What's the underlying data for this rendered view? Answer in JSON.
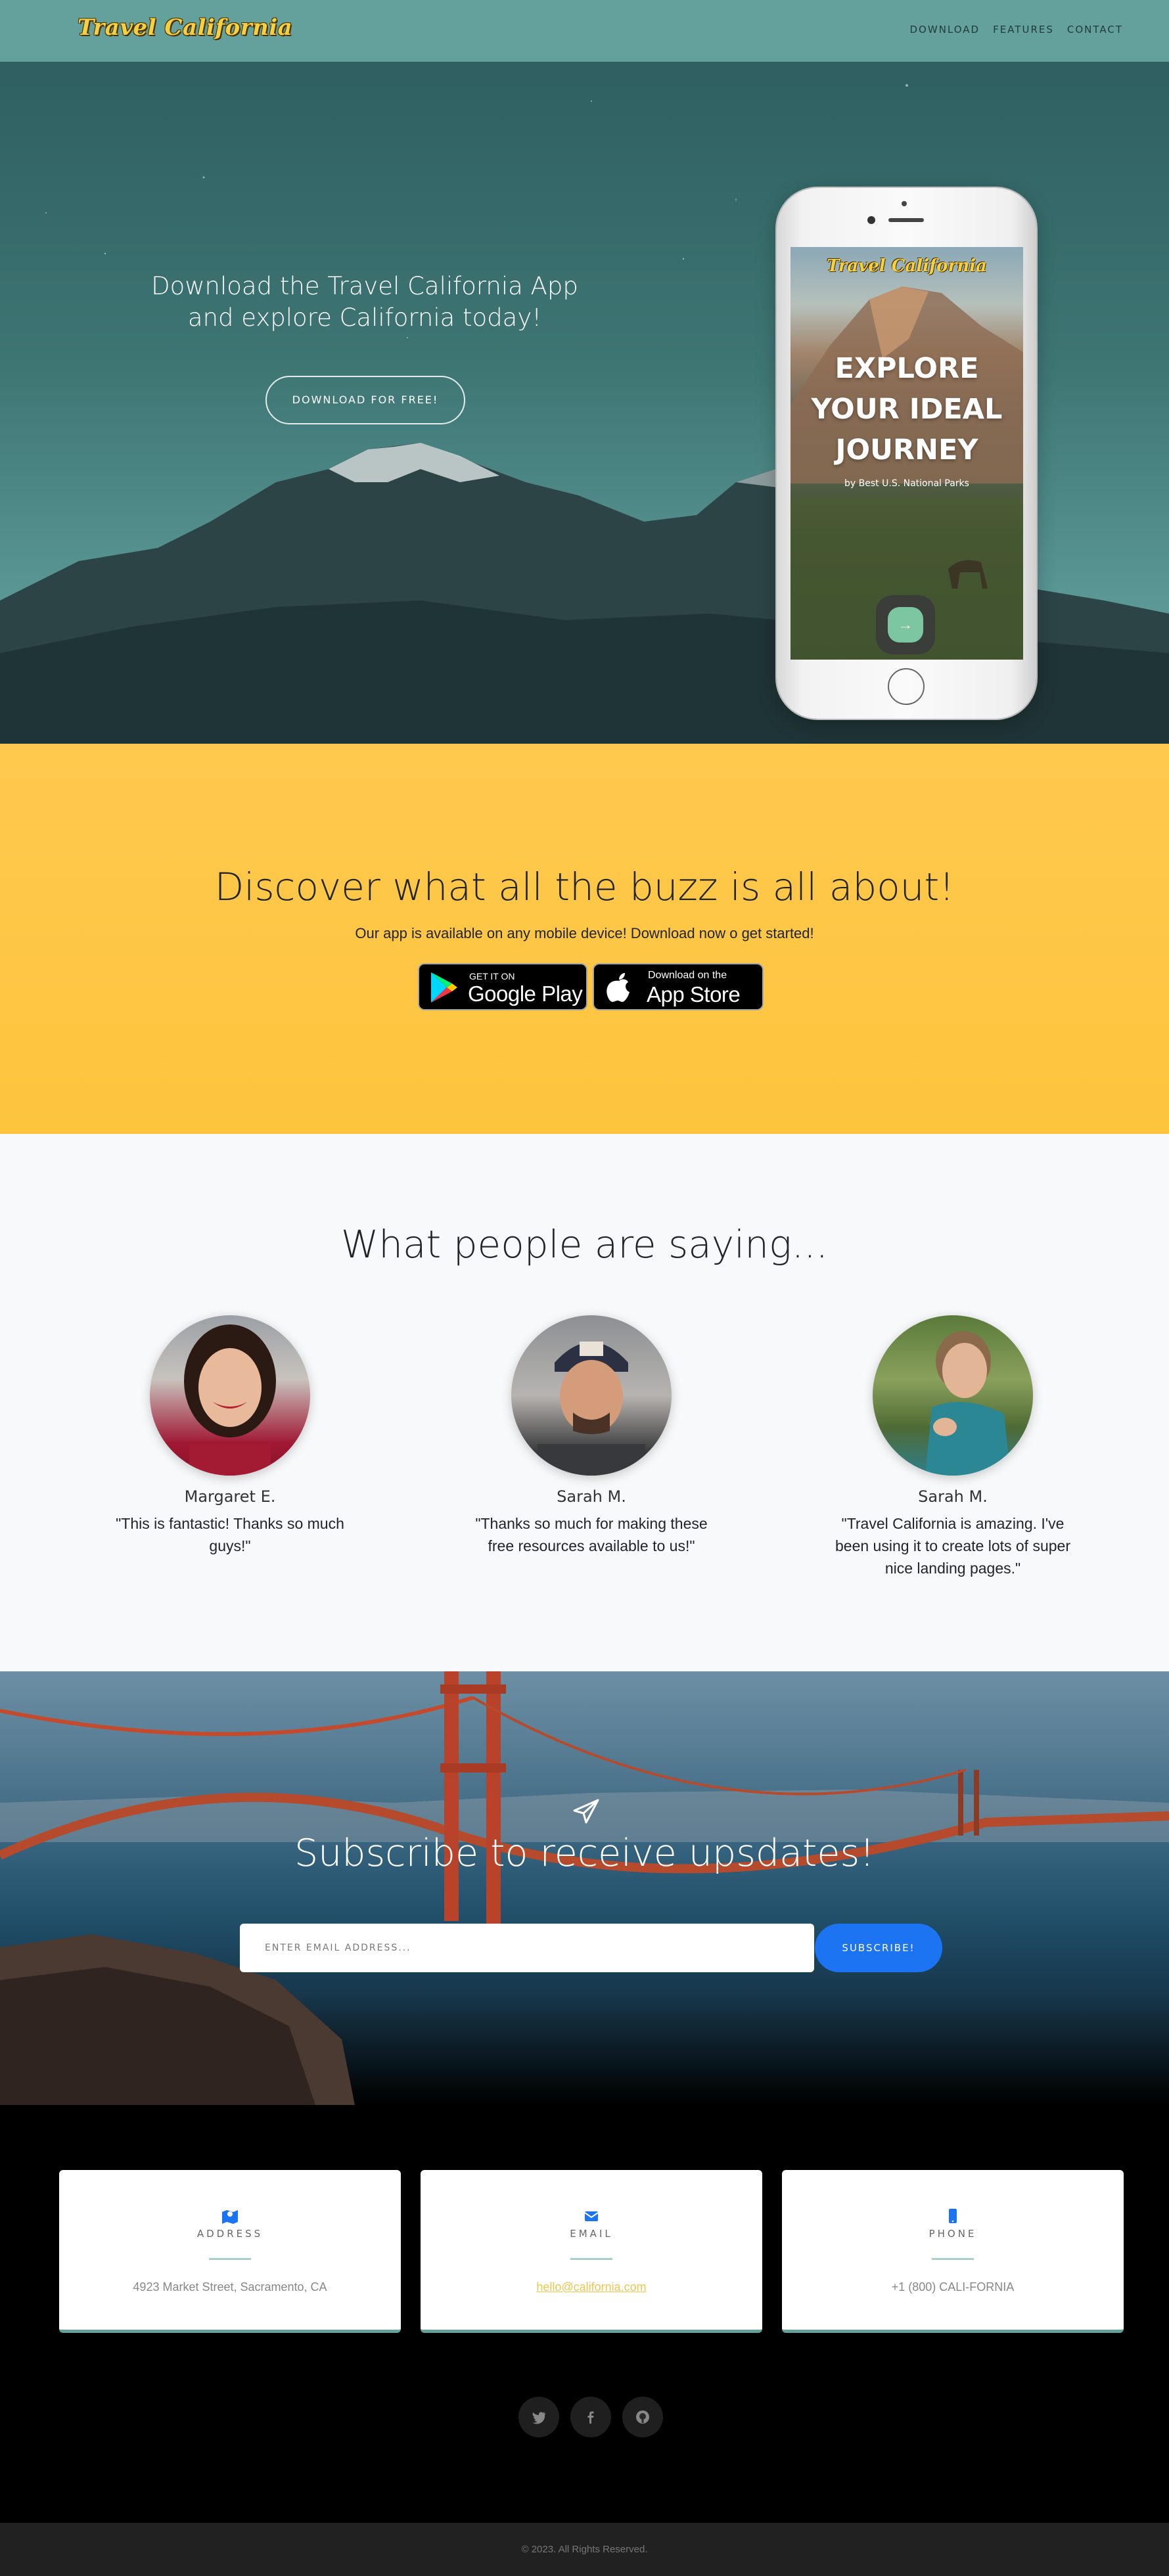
{
  "nav": {
    "brand": "Travel California",
    "links": [
      "DOWNLOAD",
      "FEATURES",
      "CONTACT"
    ]
  },
  "hero": {
    "headline": "Download the Travel California App and explore California today!",
    "button": "DOWNLOAD FOR FREE!",
    "phone_screen": {
      "brand": "Travel California",
      "title_lines": [
        "EXPLORE",
        "YOUR IDEAL",
        "JOURNEY"
      ],
      "subtitle": "by Best U.S. National Parks",
      "arrow": "→"
    }
  },
  "download": {
    "heading": "Discover what all the buzz is all about!",
    "text": "Our app is available on any mobile device! Download now o get started!",
    "google_play": {
      "small": "GET IT ON",
      "big": "Google Play"
    },
    "app_store": {
      "small": "Download on the",
      "big": "App Store"
    }
  },
  "testimonials": {
    "heading": "What people are saying...",
    "items": [
      {
        "name": "Margaret E.",
        "quote": "\"This is fantastic! Thanks so much guys!\""
      },
      {
        "name": "Sarah M.",
        "quote": "\"Thanks so much for making these free resources available to us!\""
      },
      {
        "name": "Sarah M.",
        "quote": "\"Travel California is amazing. I've been using it to create lots of super nice landing pages.\""
      }
    ]
  },
  "subscribe": {
    "icon": "paper-plane-icon",
    "heading": "Subscribe to receive upsdates!",
    "placeholder": "ENTER EMAIL ADDRESS...",
    "button": "SUBSCRIBE!"
  },
  "contact": {
    "cards": [
      {
        "icon": "map-icon",
        "title": "ADDRESS",
        "value": "4923 Market Street, Sacramento, CA"
      },
      {
        "icon": "envelope-icon",
        "title": "EMAIL",
        "value": "hello@california.com"
      },
      {
        "icon": "mobile-icon",
        "title": "PHONE",
        "value": "+1 (800) CALI-FORNIA"
      }
    ],
    "social": [
      "twitter-icon",
      "facebook-icon",
      "github-icon"
    ]
  },
  "footer": {
    "copyright": "© 2023. All Rights Reserved."
  },
  "colors": {
    "nav": "#64a19d",
    "download_bg": "#fdc43c",
    "subscribe_button": "#1c74f2",
    "card_accent": "#64a19d",
    "brand_yellow": "#f5d142"
  }
}
